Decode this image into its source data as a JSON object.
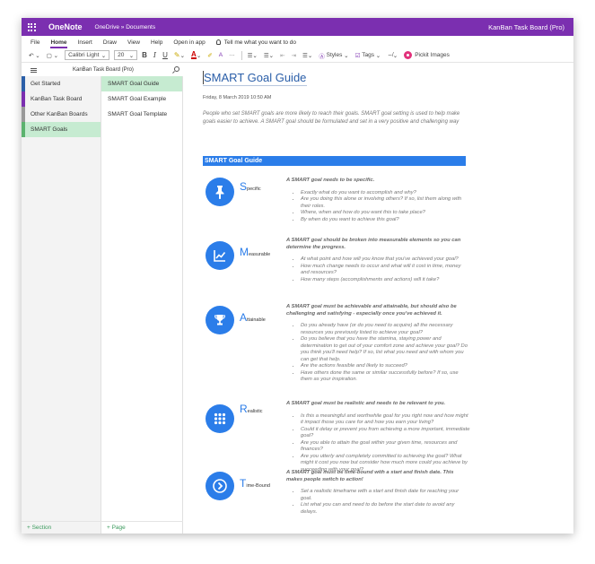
{
  "titlebar": {
    "app_name": "OneNote",
    "breadcrumb": "OneDrive » Documents",
    "notebook_name": "KanBan Task Board (Pro)"
  },
  "menu": {
    "items": [
      "File",
      "Home",
      "Insert",
      "Draw",
      "View",
      "Help",
      "Open in app"
    ],
    "active": "Home",
    "tell_me": "Tell me what you want to do"
  },
  "toolbar": {
    "undo": "↶",
    "paste": "▢",
    "font_name": "Calibri Light",
    "font_size": "20",
    "bold": "B",
    "italic": "I",
    "underline": "U",
    "highlight": "✎",
    "font_color": "A",
    "clear_format": "✐",
    "styles_glyph": "A",
    "more": "···",
    "bullets": "☰",
    "numbering": "☰",
    "outdent": "⇤",
    "indent": "⇥",
    "align": "☰",
    "styles_label": "Styles",
    "tags_label": "Tags",
    "dictate": "⇎",
    "pickit_label": "Pickit Images"
  },
  "navigation": {
    "notebook_title": "KanBan Task Board (Pro)",
    "sections": [
      {
        "label": "Get Started",
        "color": "#2b5fa8",
        "selected": false
      },
      {
        "label": "KanBan Task Board",
        "color": "#7b2fb0",
        "selected": false
      },
      {
        "label": "Other KanBan Boards",
        "color": "#999999",
        "selected": false
      },
      {
        "label": "SMART Goals",
        "color": "#5bb36e",
        "selected": true
      }
    ],
    "pages": [
      {
        "label": "SMART Goal Guide",
        "selected": true
      },
      {
        "label": "SMART Goal Example",
        "selected": false
      },
      {
        "label": "SMART Goal Template",
        "selected": false
      }
    ],
    "add_section": "+ Section",
    "add_page": "+ Page"
  },
  "page": {
    "title": "SMART Goal Guide",
    "date": "Friday, 8 March 2019    10:50 AM",
    "intro": "People who set SMART goals are more likely to reach their goals. SMART goal setting is used to help make goals easier to achieve. A SMART goal should be formulated and set in a very positive and challenging way",
    "guide_header": "SMART Goal Guide",
    "goals": [
      {
        "icon": "pin-icon",
        "letter": "S",
        "rest": "pecific",
        "heading": "A SMART goal needs to be specific.",
        "bullets": [
          "Exactly what do you want to accomplish and why?",
          "Are you doing this alone or involving others? If so, list them along with their roles.",
          "Where, when and how do you want this to take place?",
          "By when do you want to achieve this goal?"
        ]
      },
      {
        "icon": "chart-icon",
        "letter": "M",
        "rest": "easurable",
        "heading": "A SMART goal should be broken into measurable elements so you can determine the progress.",
        "bullets": [
          "At what point and how will you know that you've achieved your goal?",
          "How much change needs to occur and what will it cost in time, money and resources?",
          "How many steps (accomplishments and actions) will it take?"
        ]
      },
      {
        "icon": "trophy-icon",
        "letter": "A",
        "rest": "ttainable",
        "heading": "A SMART goal must be achievable and attainable, but should also be challenging and satisfying - especially once you've achieved it.",
        "bullets": [
          "Do you already have (or do you need to acquire) all the necessary resources you previously listed to achieve your goal?",
          "Do you believe that you have the stamina, staying power and determination to get out of your comfort zone and achieve your goal? Do you think you'll need help? If so, list what you need and with whom you can get that help.",
          "Are the actions feasible and likely to succeed?",
          "Have others done the same or similar successfully before? If so, use them as your inspiration."
        ]
      },
      {
        "icon": "grid-icon",
        "letter": "R",
        "rest": "ealistic",
        "heading": "A SMART goal must be realistic and needs to be relevant to you.",
        "bullets": [
          "Is this a meaningful and worthwhile goal for you right now and how might it impact those you care for and how you earn your living?",
          "Could it delay or prevent you from achieving a more important, immediate goal?",
          "Are you able to attain the goal within your given time, resources and finances?",
          "Are you utterly and completely committed to achieving the goal? What might it cost you now but consider how much more could you achieve by succeeding with your goal?"
        ]
      },
      {
        "icon": "chevron-right-icon",
        "letter": "T",
        "rest": "ime-Bound",
        "heading": "A SMART goal must be time-bound with a start and finish date. This makes people switch to action!",
        "bullets": [
          "Set a realistic timeframe with a start and finish date for reaching your goal.",
          "List what you can and need to do before the start date to avoid any delays."
        ]
      }
    ]
  }
}
